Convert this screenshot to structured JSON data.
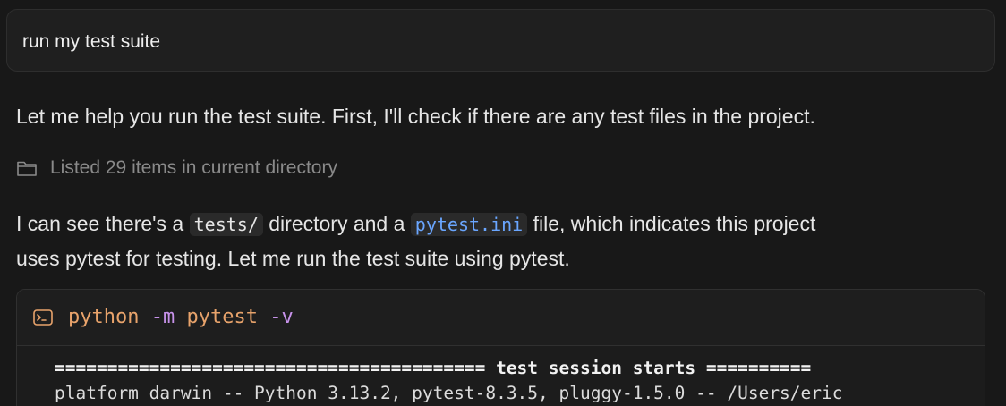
{
  "user_message": {
    "text": "run my test suite"
  },
  "assistant": {
    "intro": "Let me help you run the test suite. First, I'll check if there are any test files in the project.",
    "tool_call": {
      "icon": "folder-icon",
      "text": "Listed 29 items in current directory"
    },
    "explanation": {
      "part1": "I can see there's a ",
      "code1": "tests/",
      "part2": " directory and a ",
      "code2": "pytest.ini",
      "part3": " file, which indicates this project",
      "line2": "uses pytest for testing. Let me run the test suite using pytest."
    }
  },
  "terminal": {
    "icon": "terminal-icon",
    "command": {
      "name": "python",
      "arg1": " -m",
      "arg2": " pytest",
      "arg3": " -v"
    },
    "output": {
      "session_line": "========================================= test session starts ==========",
      "platform_line": "platform darwin -- Python 3.13.2, pytest-8.3.5, pluggy-1.5.0 -- /Users/eric"
    }
  },
  "colors": {
    "background": "#181818",
    "link_code": "#6aa6ff",
    "command_name": "#e8a36b",
    "command_args": "#c792ea"
  }
}
